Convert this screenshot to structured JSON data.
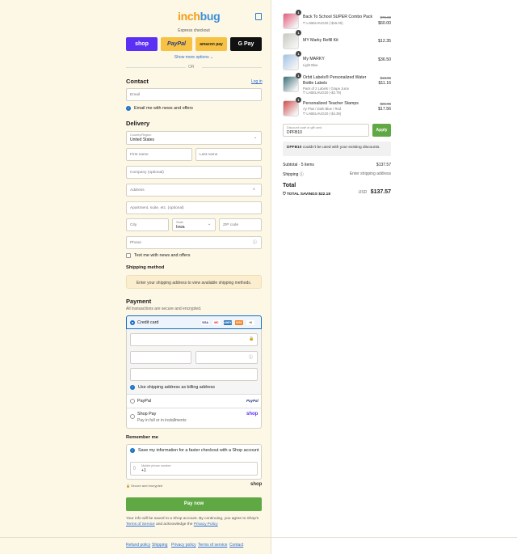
{
  "brand": {
    "part1": "inch",
    "part2": "bug"
  },
  "express": {
    "title": "Express checkout",
    "buttons": [
      "shop",
      "PayPal",
      "amazon pay",
      "G Pay"
    ],
    "show_more": "Show more options ⌄",
    "or": "OR"
  },
  "contact": {
    "title": "Contact",
    "login": "Log in",
    "email_placeholder": "Email",
    "news_label": "Email me with news and offers"
  },
  "delivery": {
    "title": "Delivery",
    "country_label": "Country/Region",
    "country_value": "United States",
    "first_name": "First name",
    "last_name": "Last name",
    "company": "Company (optional)",
    "address": "Address",
    "apartment": "Apartment, suite, etc. (optional)",
    "city": "City",
    "state_label": "State",
    "state_value": "Iowa",
    "zip": "ZIP code",
    "phone": "Phone",
    "text_me": "Text me with news and offers"
  },
  "shipping": {
    "title": "Shipping method",
    "notice": "Enter your shipping address to view available shipping methods."
  },
  "payment": {
    "title": "Payment",
    "subtitle": "All transactions are secure and encrypted.",
    "credit_card": "Credit card",
    "card_brands": [
      "VISA",
      "MC",
      "AMEX",
      "DISC",
      "+6"
    ],
    "billing_same": "Use shipping address as billing address",
    "paypal": "PayPal",
    "paypal_logo": "PayPal",
    "shop_pay": "Shop Pay",
    "shop_pay_sub": "Pay in full or in installments",
    "shop_logo": "shop"
  },
  "remember": {
    "title": "Remember me",
    "save_info": "Save my information for a faster checkout with a Shop account",
    "mobile_label": "Mobile phone number",
    "mobile_value": "+1",
    "secure": "Secure and encrypted",
    "shop_logo": "shop"
  },
  "pay_now": "Pay now",
  "legal": {
    "line1": "Your info will be saved to a Shop account. By continuing, you agree to Shop's",
    "terms": "Terms of Service",
    "and": "and acknowledge the",
    "privacy": "Privacy Policy"
  },
  "footer": [
    "Refund policy",
    "Shipping",
    "Privacy policy",
    "Terms of service",
    "Contact"
  ],
  "cart": {
    "items": [
      {
        "qty": "1",
        "name": "Back To School SUPER Combo Pack",
        "sub": "LABELHUG20 (-$15.00)",
        "old": "$75.00",
        "price": "$60.00",
        "color": "#e65a7a"
      },
      {
        "qty": "1",
        "name": "MY Marky Refill Kit",
        "sub": "",
        "old": "",
        "price": "$12.35",
        "color": "#c9c9c0"
      },
      {
        "qty": "1",
        "name": "My MARKY",
        "sub": "Light Blue",
        "old": "",
        "price": "$36.50",
        "color": "#9fc4e8"
      },
      {
        "qty": "1",
        "name": "Orbit Labels® Personalized Water Bottle Labels",
        "sub": "Pack of 2 Labels / Grape Juice",
        "sub2": "LABELHUG20 (-$2.79)",
        "old": "$13.95",
        "price": "$11.16",
        "color": "#3a6e78"
      },
      {
        "qty": "1",
        "name": "Personalized Teacher Stamps",
        "sub": "Ay Plus / Dark Blue / Red",
        "sub2": "LABELHUG20 (-$4.39)",
        "old": "$21.95",
        "price": "$17.56",
        "color": "#d24b4b"
      }
    ],
    "discount_label": "Discount code or gift card",
    "discount_value": "DPFB10",
    "apply": "Apply",
    "error_code": "DPFB10",
    "error_text": " couldn't be used with your existing discounts.",
    "subtotal_label": "Subtotal · 5 items",
    "subtotal": "$137.57",
    "shipping_label": "Shipping",
    "shipping_value": "Enter shipping address",
    "total_label": "Total",
    "currency": "USD",
    "total": "$137.57",
    "savings_label": "TOTAL SAVINGS",
    "savings": "$22.18"
  }
}
